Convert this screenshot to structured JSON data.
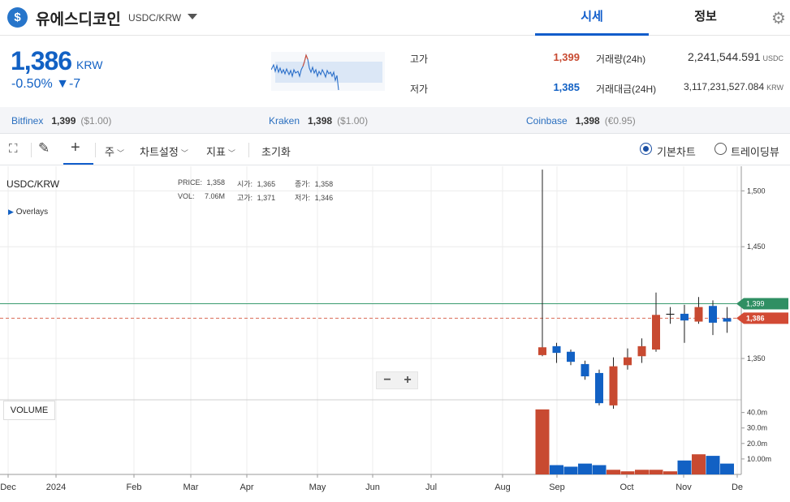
{
  "header": {
    "coin_icon": "dollar-coin-icon",
    "coin_name": "유에스디코인",
    "pair": "USDC/KRW",
    "tabs": [
      {
        "label": "시세",
        "active": true
      },
      {
        "label": "정보",
        "active": false
      }
    ],
    "settings_icon": "gear-icon"
  },
  "summary": {
    "price": "1,386",
    "unit": "KRW",
    "change": "-0.50% ▼-7",
    "high_label": "고가",
    "high_value": "1,399",
    "low_label": "저가",
    "low_value": "1,385",
    "volume_label": "거래량(24h)",
    "volume_value": "2,241,544.591",
    "volume_unit": "USDC",
    "amount_label": "거래대금(24H)",
    "amount_value": "3,117,231,527.084",
    "amount_unit": "KRW"
  },
  "exchanges": [
    {
      "name": "Bitfinex",
      "price": "1,399",
      "usd": "($1.00)"
    },
    {
      "name": "Kraken",
      "price": "1,398",
      "usd": "($1.00)"
    },
    {
      "name": "Coinbase",
      "price": "1,398",
      "usd": "(€0.95)"
    }
  ],
  "toolbar": {
    "period": "주",
    "chart_settings": "차트설정",
    "indicators": "지표",
    "reset": "초기화",
    "basic_chart": "기본차트",
    "trading_view": "트레이딩뷰",
    "basic_selected": true
  },
  "legend": {
    "title": "USDC/KRW",
    "price_label": "PRICE:",
    "price_val": "1,358",
    "open_label": "시가:",
    "open_val": "1,365",
    "close_label": "종가:",
    "close_val": "1,358",
    "vol_label": "VOL:",
    "vol_val": "7.06M",
    "high_label": "고가:",
    "high_val": "1,371",
    "low_label": "저가:",
    "low_val": "1,346",
    "overlays": "Overlays"
  },
  "volume_label": "VOLUME",
  "colors": {
    "up": "#c84a31",
    "down": "#1261c4",
    "accent": "#115dcb",
    "ref_line": "#3a9b6f"
  },
  "chart_data": {
    "type": "candlestick",
    "x_ticks": [
      "Dec",
      "2024",
      "Feb",
      "Mar",
      "Apr",
      "May",
      "Jun",
      "Jul",
      "Aug",
      "Sep",
      "Oct",
      "Nov",
      "De"
    ],
    "y_ticks": [
      "1,500",
      "1,450",
      "1,350"
    ],
    "vol_ticks": [
      "40.0m",
      "30.0m",
      "20.0m",
      "10.00m"
    ],
    "ylim": [
      1313,
      1522
    ],
    "vol_max": 44,
    "last_price": {
      "value": 1386,
      "label": "1,386"
    },
    "ref_price": {
      "value": 1399,
      "label": "1,399"
    },
    "candles": [
      {
        "o": 1353,
        "c": 1360,
        "h": 1519,
        "l": 1352,
        "v": 42
      },
      {
        "o": 1361,
        "c": 1355,
        "h": 1364,
        "l": 1346,
        "v": 6
      },
      {
        "o": 1356,
        "c": 1347,
        "h": 1358,
        "l": 1344,
        "v": 5
      },
      {
        "o": 1345,
        "c": 1334,
        "h": 1348,
        "l": 1331,
        "v": 7
      },
      {
        "o": 1337,
        "c": 1310,
        "h": 1340,
        "l": 1308,
        "v": 6
      },
      {
        "o": 1308,
        "c": 1343,
        "h": 1351,
        "l": 1305,
        "v": 3
      },
      {
        "o": 1344,
        "c": 1351,
        "h": 1359,
        "l": 1340,
        "v": 2
      },
      {
        "o": 1352,
        "c": 1361,
        "h": 1368,
        "l": 1346,
        "v": 3
      },
      {
        "o": 1358,
        "c": 1389,
        "h": 1409,
        "l": 1356,
        "v": 3
      },
      {
        "o": 1390,
        "c": 1390,
        "h": 1396,
        "l": 1381,
        "v": 2
      },
      {
        "o": 1390,
        "c": 1384,
        "h": 1398,
        "l": 1364,
        "v": 9
      },
      {
        "o": 1383,
        "c": 1396,
        "h": 1405,
        "l": 1381,
        "v": 13
      },
      {
        "o": 1397,
        "c": 1382,
        "h": 1402,
        "l": 1371,
        "v": 12
      },
      {
        "o": 1386,
        "c": 1383,
        "h": 1396,
        "l": 1373,
        "v": 7
      }
    ]
  }
}
